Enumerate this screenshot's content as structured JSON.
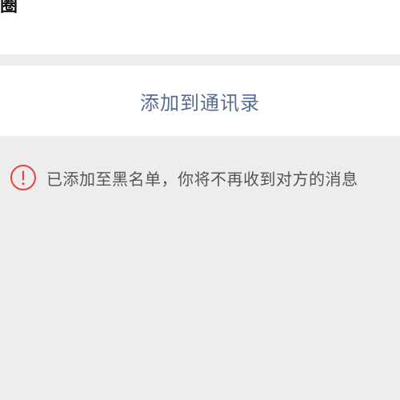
{
  "top_section": {
    "partial_text": "圈"
  },
  "action": {
    "add_to_contacts_label": "添加到通讯录"
  },
  "notice": {
    "icon": "exclamation-circle-icon",
    "icon_color": "#e64340",
    "text": "已添加至黑名单，你将不再收到对方的消息"
  },
  "colors": {
    "link": "#576b95",
    "background": "#ededed",
    "panel": "#ffffff"
  }
}
